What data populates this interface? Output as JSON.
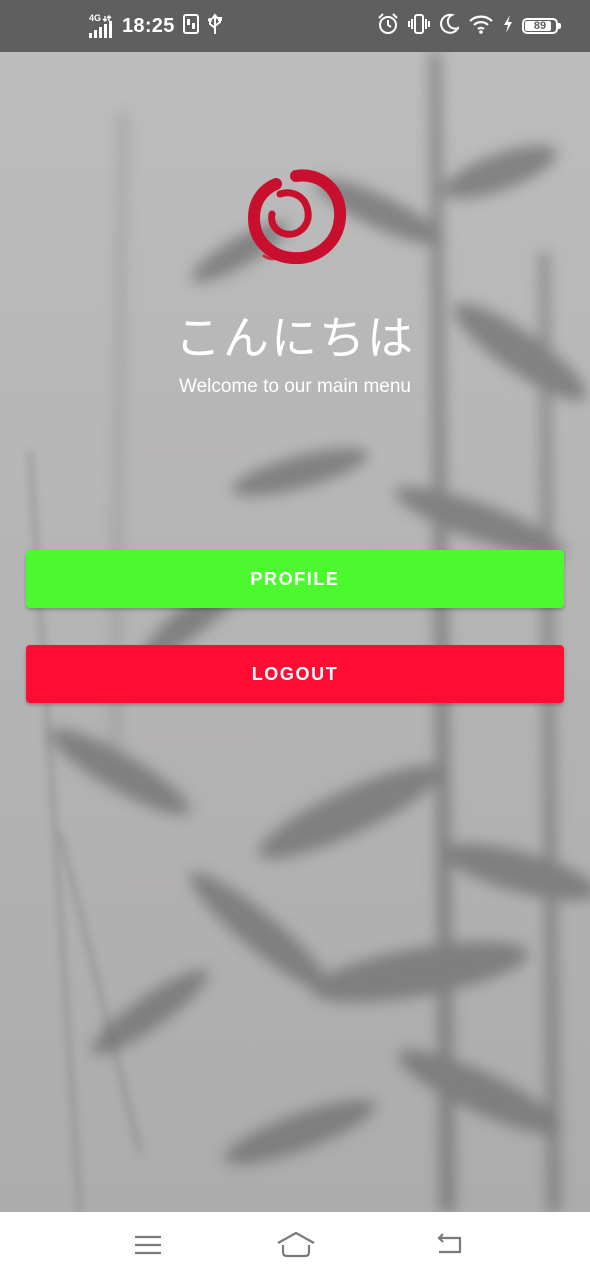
{
  "status_bar": {
    "network": "4G",
    "time": "18:25",
    "battery_level": "89",
    "icons": [
      "signal-icon",
      "data-saver-icon",
      "usb-icon",
      "alarm-icon",
      "vibrate-icon",
      "moon-icon",
      "wifi-icon",
      "charging-icon",
      "battery-icon"
    ]
  },
  "main": {
    "logo_icon": "enso-circle-logo",
    "greeting": "こんにちは",
    "subtitle": "Welcome to our main menu"
  },
  "buttons": {
    "profile_label": "PROFILE",
    "logout_label": "LOGOUT"
  },
  "nav_bar": {
    "icons": [
      "menu-icon",
      "home-icon",
      "back-icon"
    ]
  },
  "colors": {
    "status_bar_bg": "#5f5f5f",
    "background": "#b3b2b2",
    "profile_button": "#4cf92e",
    "logout_button": "#ff0b33",
    "logo_red": "#c8102e",
    "text": "#ffffff"
  }
}
